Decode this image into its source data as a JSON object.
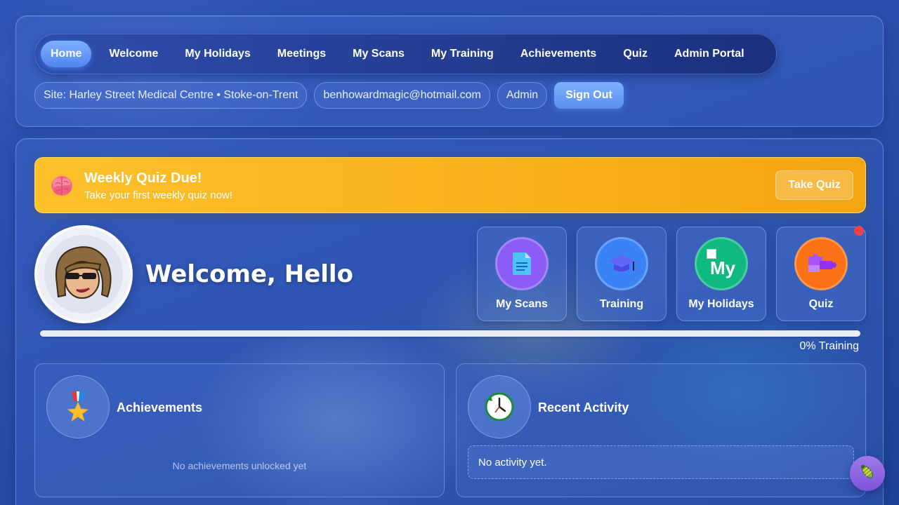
{
  "nav": {
    "items": [
      {
        "label": "Home",
        "active": true
      },
      {
        "label": "Welcome"
      },
      {
        "label": "My Holidays"
      },
      {
        "label": "Meetings"
      },
      {
        "label": "My Scans"
      },
      {
        "label": "My Training"
      },
      {
        "label": "Achievements"
      },
      {
        "label": "Quiz"
      },
      {
        "label": "Admin Portal"
      }
    ]
  },
  "user_info": {
    "site": "Site: Harley Street Medical Centre • Stoke-on-Trent",
    "email": "benhowardmagic@hotmail.com",
    "role": "Admin",
    "sign_out_label": "Sign Out"
  },
  "quiz_banner": {
    "title": "Weekly Quiz Due!",
    "subtitle": "Take your first weekly quiz now!",
    "button_label": "Take Quiz",
    "icon": "brain-icon"
  },
  "welcome": {
    "heading": "Welcome, Hello"
  },
  "tiles": [
    {
      "label": "My Scans",
      "icon": "document-icon",
      "color": "#8b5cf6"
    },
    {
      "label": "Training",
      "icon": "graduation-cap-icon",
      "color": "#3b82f6"
    },
    {
      "label": "My Holidays",
      "icon": "broken-image-icon",
      "color": "#10b981",
      "img_alt": "My"
    },
    {
      "label": "Quiz",
      "icon": "puzzle-icon",
      "color": "#f97316",
      "has_notification": true
    }
  ],
  "training_progress": {
    "percent": 0,
    "label": "0% Training"
  },
  "achievements": {
    "title": "Achievements",
    "icon": "medal-icon",
    "empty_text": "No achievements unlocked yet"
  },
  "recent_activity": {
    "title": "Recent Activity",
    "icon": "clock-icon",
    "empty_text": "No activity yet."
  },
  "floating_button": {
    "icon": "bug-icon"
  }
}
